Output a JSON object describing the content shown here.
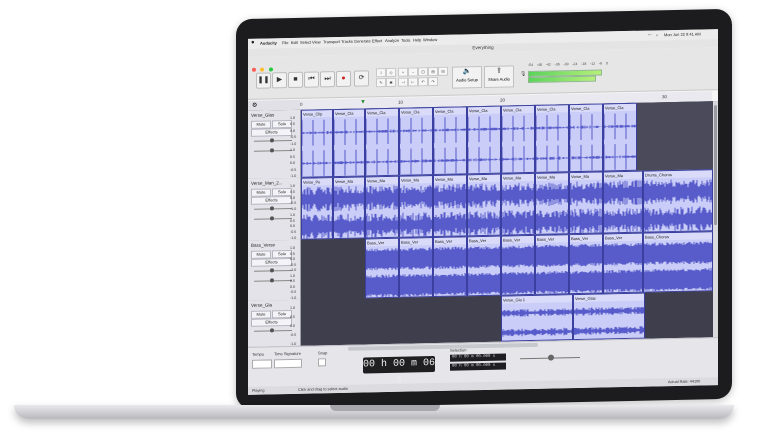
{
  "menubar": {
    "items": [
      "Audacity",
      "File",
      "Edit",
      "Select",
      "View",
      "Transport",
      "Tracks",
      "Generate",
      "Effect",
      "Analyze",
      "Tools",
      "Help",
      "Window"
    ],
    "clock": "Mon Jun 22 9:41 AM"
  },
  "window": {
    "title": "Everything"
  },
  "toolbar": {
    "audio_setup_label": "Audio Setup",
    "share_audio_label": "Share Audio",
    "meter_ticks": [
      "-54",
      "-48",
      "-42",
      "-36",
      "-30",
      "-24",
      "-18",
      "-12",
      "-6",
      "0"
    ]
  },
  "ruler": {
    "ticks": [
      "0",
      "10",
      "20",
      "30"
    ]
  },
  "tracks": [
    {
      "name": "Verse_Glas",
      "mute": "Mute",
      "solo": "Solo",
      "effects": "Effects",
      "scale": [
        "1.0",
        "0.5",
        "0.0",
        "-0.5",
        "-1.0",
        "1.0",
        "0.5",
        "0.0",
        "-0.5",
        "-1.0"
      ],
      "clips": [
        "Verse_Clip",
        "Verse_Cla",
        "Verse_Cla",
        "Verse_Cla",
        "Verse_Cla",
        "Verse_Cla",
        "Verse_Cla",
        "Verse_Cla",
        "Verse_Cla",
        "Verse_Cla",
        "Verse_Cla"
      ]
    },
    {
      "name": "Verse_Man_2...",
      "mute": "Mute",
      "solo": "Solo",
      "effects": "Effects",
      "scale": [
        "1.0",
        "0.5",
        "0.0",
        "-0.5",
        "-1.0",
        "1.0",
        "0.5",
        "0.0",
        "-0.5",
        "-1.0"
      ],
      "clips": [
        "Verse_Pe",
        "Verse_Ma",
        "Verse_Ma",
        "Verse_Ma",
        "Verse_Ma",
        "Verse_Ma",
        "Verse_Ma",
        "Verse_Ma",
        "Verse_Ma",
        "Verse_Ma",
        "Drums_Chorus"
      ]
    },
    {
      "name": "Bass_Verse",
      "mute": "Mute",
      "solo": "Solo",
      "effects": "Effects",
      "scale": [
        "1.0",
        "0.5",
        "0.0",
        "-0.5",
        "-1.0",
        "1.0",
        "0.5",
        "0.0",
        "-0.5",
        "-1.0"
      ],
      "clips": [
        "Bass_Ver",
        "Bass_Ver",
        "Bass_Ver",
        "Bass_Ver",
        "Bass_Ver",
        "Bass_Ver",
        "Bass_Ver",
        "Bass_Ver",
        "Bass_Chorus"
      ]
    },
    {
      "name": "Verse_Gla",
      "mute": "Mute",
      "solo": "Solo",
      "effects": "Effects",
      "scale": [
        "1.0",
        "0.5",
        "0.0",
        "-0.5",
        "-1.0"
      ],
      "clips": [
        "Verse_Gla 1",
        "Verse_Glas"
      ]
    }
  ],
  "bottom": {
    "tempo_label": "Tempo",
    "time_signature_label": "Time Signature",
    "snap_label": "Snap",
    "time_display": "00 h 00 m 06 s",
    "selection_label": "Selection",
    "selection_start": "00 h 00 m 00.000 s",
    "selection_end": "00 h 00 m 00.000 s"
  },
  "status": {
    "left": "Playing",
    "hint": "Click and drag to select audio",
    "rate": "Actual Rate: 44100"
  }
}
